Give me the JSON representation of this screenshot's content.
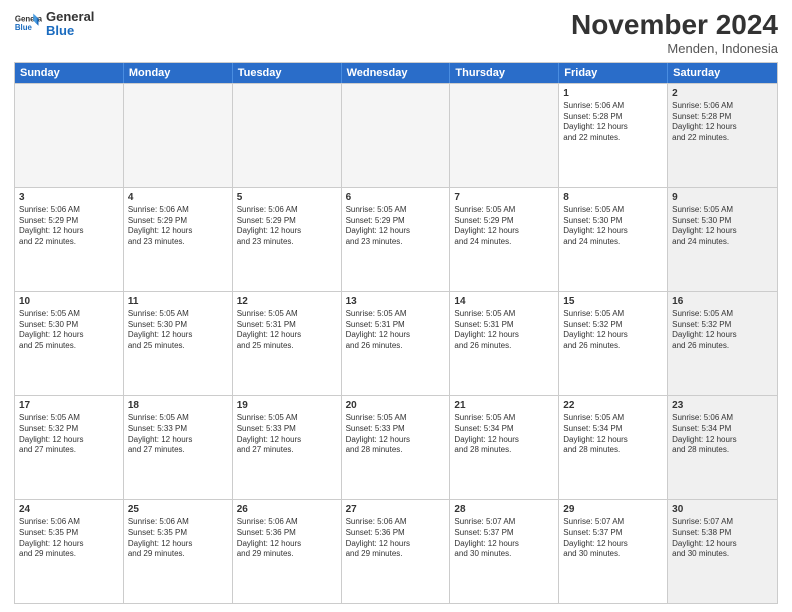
{
  "header": {
    "logo_line1": "General",
    "logo_line2": "Blue",
    "month_title": "November 2024",
    "location": "Menden, Indonesia"
  },
  "weekdays": [
    "Sunday",
    "Monday",
    "Tuesday",
    "Wednesday",
    "Thursday",
    "Friday",
    "Saturday"
  ],
  "weeks": [
    [
      {
        "day": "",
        "info": "",
        "empty": true
      },
      {
        "day": "",
        "info": "",
        "empty": true
      },
      {
        "day": "",
        "info": "",
        "empty": true
      },
      {
        "day": "",
        "info": "",
        "empty": true
      },
      {
        "day": "",
        "info": "",
        "empty": true
      },
      {
        "day": "1",
        "info": "Sunrise: 5:06 AM\nSunset: 5:28 PM\nDaylight: 12 hours\nand 22 minutes.",
        "empty": false
      },
      {
        "day": "2",
        "info": "Sunrise: 5:06 AM\nSunset: 5:28 PM\nDaylight: 12 hours\nand 22 minutes.",
        "empty": false
      }
    ],
    [
      {
        "day": "3",
        "info": "Sunrise: 5:06 AM\nSunset: 5:29 PM\nDaylight: 12 hours\nand 22 minutes.",
        "empty": false
      },
      {
        "day": "4",
        "info": "Sunrise: 5:06 AM\nSunset: 5:29 PM\nDaylight: 12 hours\nand 23 minutes.",
        "empty": false
      },
      {
        "day": "5",
        "info": "Sunrise: 5:06 AM\nSunset: 5:29 PM\nDaylight: 12 hours\nand 23 minutes.",
        "empty": false
      },
      {
        "day": "6",
        "info": "Sunrise: 5:05 AM\nSunset: 5:29 PM\nDaylight: 12 hours\nand 23 minutes.",
        "empty": false
      },
      {
        "day": "7",
        "info": "Sunrise: 5:05 AM\nSunset: 5:29 PM\nDaylight: 12 hours\nand 24 minutes.",
        "empty": false
      },
      {
        "day": "8",
        "info": "Sunrise: 5:05 AM\nSunset: 5:30 PM\nDaylight: 12 hours\nand 24 minutes.",
        "empty": false
      },
      {
        "day": "9",
        "info": "Sunrise: 5:05 AM\nSunset: 5:30 PM\nDaylight: 12 hours\nand 24 minutes.",
        "empty": false
      }
    ],
    [
      {
        "day": "10",
        "info": "Sunrise: 5:05 AM\nSunset: 5:30 PM\nDaylight: 12 hours\nand 25 minutes.",
        "empty": false
      },
      {
        "day": "11",
        "info": "Sunrise: 5:05 AM\nSunset: 5:30 PM\nDaylight: 12 hours\nand 25 minutes.",
        "empty": false
      },
      {
        "day": "12",
        "info": "Sunrise: 5:05 AM\nSunset: 5:31 PM\nDaylight: 12 hours\nand 25 minutes.",
        "empty": false
      },
      {
        "day": "13",
        "info": "Sunrise: 5:05 AM\nSunset: 5:31 PM\nDaylight: 12 hours\nand 26 minutes.",
        "empty": false
      },
      {
        "day": "14",
        "info": "Sunrise: 5:05 AM\nSunset: 5:31 PM\nDaylight: 12 hours\nand 26 minutes.",
        "empty": false
      },
      {
        "day": "15",
        "info": "Sunrise: 5:05 AM\nSunset: 5:32 PM\nDaylight: 12 hours\nand 26 minutes.",
        "empty": false
      },
      {
        "day": "16",
        "info": "Sunrise: 5:05 AM\nSunset: 5:32 PM\nDaylight: 12 hours\nand 26 minutes.",
        "empty": false
      }
    ],
    [
      {
        "day": "17",
        "info": "Sunrise: 5:05 AM\nSunset: 5:32 PM\nDaylight: 12 hours\nand 27 minutes.",
        "empty": false
      },
      {
        "day": "18",
        "info": "Sunrise: 5:05 AM\nSunset: 5:33 PM\nDaylight: 12 hours\nand 27 minutes.",
        "empty": false
      },
      {
        "day": "19",
        "info": "Sunrise: 5:05 AM\nSunset: 5:33 PM\nDaylight: 12 hours\nand 27 minutes.",
        "empty": false
      },
      {
        "day": "20",
        "info": "Sunrise: 5:05 AM\nSunset: 5:33 PM\nDaylight: 12 hours\nand 28 minutes.",
        "empty": false
      },
      {
        "day": "21",
        "info": "Sunrise: 5:05 AM\nSunset: 5:34 PM\nDaylight: 12 hours\nand 28 minutes.",
        "empty": false
      },
      {
        "day": "22",
        "info": "Sunrise: 5:05 AM\nSunset: 5:34 PM\nDaylight: 12 hours\nand 28 minutes.",
        "empty": false
      },
      {
        "day": "23",
        "info": "Sunrise: 5:06 AM\nSunset: 5:34 PM\nDaylight: 12 hours\nand 28 minutes.",
        "empty": false
      }
    ],
    [
      {
        "day": "24",
        "info": "Sunrise: 5:06 AM\nSunset: 5:35 PM\nDaylight: 12 hours\nand 29 minutes.",
        "empty": false
      },
      {
        "day": "25",
        "info": "Sunrise: 5:06 AM\nSunset: 5:35 PM\nDaylight: 12 hours\nand 29 minutes.",
        "empty": false
      },
      {
        "day": "26",
        "info": "Sunrise: 5:06 AM\nSunset: 5:36 PM\nDaylight: 12 hours\nand 29 minutes.",
        "empty": false
      },
      {
        "day": "27",
        "info": "Sunrise: 5:06 AM\nSunset: 5:36 PM\nDaylight: 12 hours\nand 29 minutes.",
        "empty": false
      },
      {
        "day": "28",
        "info": "Sunrise: 5:07 AM\nSunset: 5:37 PM\nDaylight: 12 hours\nand 30 minutes.",
        "empty": false
      },
      {
        "day": "29",
        "info": "Sunrise: 5:07 AM\nSunset: 5:37 PM\nDaylight: 12 hours\nand 30 minutes.",
        "empty": false
      },
      {
        "day": "30",
        "info": "Sunrise: 5:07 AM\nSunset: 5:38 PM\nDaylight: 12 hours\nand 30 minutes.",
        "empty": false
      }
    ]
  ]
}
